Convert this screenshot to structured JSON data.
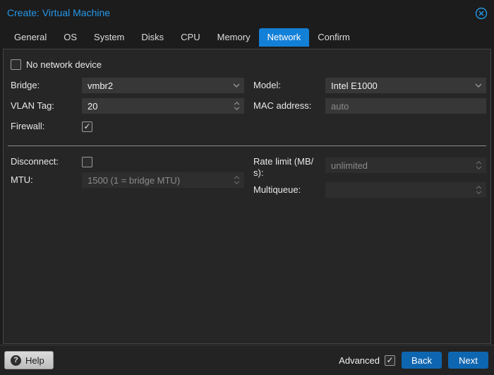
{
  "window": {
    "title": "Create: Virtual Machine"
  },
  "tabs": [
    "General",
    "OS",
    "System",
    "Disks",
    "CPU",
    "Memory",
    "Network",
    "Confirm"
  ],
  "active_tab": "Network",
  "form": {
    "no_network_device": {
      "label": "No network device",
      "checked": false,
      "check_glyph": "✓"
    },
    "bridge": {
      "label": "Bridge:",
      "value": "vmbr2"
    },
    "model": {
      "label": "Model:",
      "value": "Intel E1000"
    },
    "vlan_tag": {
      "label": "VLAN Tag:",
      "value": "20"
    },
    "mac_address": {
      "label": "MAC address:",
      "placeholder": "auto"
    },
    "firewall": {
      "label": "Firewall:",
      "checked": true,
      "check_glyph": "✓"
    },
    "disconnect": {
      "label": "Disconnect:",
      "checked": false,
      "check_glyph": "✓"
    },
    "rate_limit": {
      "label": "Rate limit (MB/\ns):",
      "placeholder": "unlimited",
      "disabled": true
    },
    "mtu": {
      "label": "MTU:",
      "placeholder": "1500 (1 = bridge MTU)",
      "disabled": true
    },
    "multiqueue": {
      "label": "Multiqueue:",
      "value": "",
      "disabled": true
    }
  },
  "footer": {
    "help_label": "Help",
    "help_icon_glyph": "?",
    "advanced_label": "Advanced",
    "advanced_checked": true,
    "check_glyph": "✓",
    "back_label": "Back",
    "next_label": "Next"
  },
  "colors": {
    "title_blue": "#2597e8",
    "active_tab_blue": "#1380d8",
    "button_blue": "#0f66b0",
    "panel_bg": "#262626",
    "field_bg": "#373737",
    "field_disabled_bg": "#2e2e2e",
    "placeholder_text": "#8b8b8b"
  }
}
